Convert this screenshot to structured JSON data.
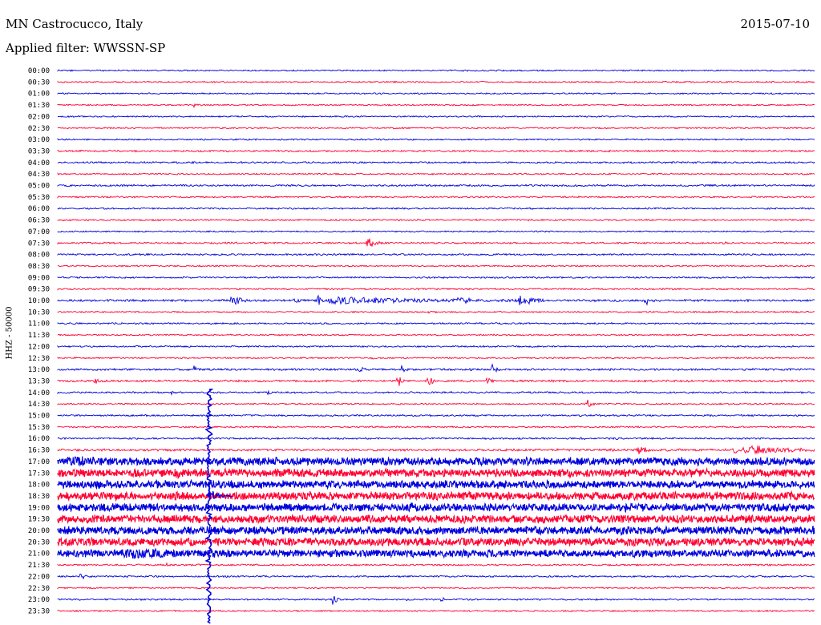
{
  "header": {
    "station": "MN Castrocucco, Italy",
    "date": "2015-07-10",
    "filter": "Applied filter: WWSSN-SP",
    "channel_label": "HHZ - 50000"
  },
  "chart_data": {
    "type": "line",
    "title": "MN Castrocucco, Italy",
    "x_unit": "minutes past row start",
    "xlim": [
      0,
      30
    ],
    "series_colors": [
      "#0000dd",
      "#ff0033"
    ],
    "rows": [
      {
        "label": "00:00",
        "amp": 1,
        "events": []
      },
      {
        "label": "00:30",
        "amp": 1,
        "events": []
      },
      {
        "label": "01:00",
        "amp": 1,
        "events": []
      },
      {
        "label": "01:30",
        "amp": 1,
        "events": [
          [
            5.4,
            2,
            0.3
          ]
        ]
      },
      {
        "label": "02:00",
        "amp": 1,
        "events": []
      },
      {
        "label": "02:30",
        "amp": 1,
        "events": []
      },
      {
        "label": "03:00",
        "amp": 1,
        "events": []
      },
      {
        "label": "03:30",
        "amp": 1.2,
        "events": []
      },
      {
        "label": "04:00",
        "amp": 1.2,
        "events": []
      },
      {
        "label": "04:30",
        "amp": 1,
        "events": []
      },
      {
        "label": "05:00",
        "amp": 1.3,
        "events": []
      },
      {
        "label": "05:30",
        "amp": 1.1,
        "events": []
      },
      {
        "label": "06:00",
        "amp": 1.1,
        "events": []
      },
      {
        "label": "06:30",
        "amp": 1.1,
        "events": []
      },
      {
        "label": "07:00",
        "amp": 1,
        "events": []
      },
      {
        "label": "07:30",
        "amp": 1.2,
        "events": [
          [
            12.2,
            10,
            0.7
          ],
          [
            26.4,
            2,
            0.2
          ]
        ]
      },
      {
        "label": "08:00",
        "amp": 1.2,
        "events": []
      },
      {
        "label": "08:30",
        "amp": 1,
        "events": []
      },
      {
        "label": "09:00",
        "amp": 1.1,
        "events": []
      },
      {
        "label": "09:30",
        "amp": 1.1,
        "events": []
      },
      {
        "label": "10:00",
        "amp": 1.5,
        "events": [
          [
            6.9,
            10,
            0.6
          ],
          [
            9.4,
            4,
            0.3
          ],
          [
            10.3,
            8,
            0.5
          ],
          [
            10.8,
            4,
            8.0
          ],
          [
            15.9,
            8,
            0.5
          ],
          [
            18.3,
            9,
            1.0
          ],
          [
            23.3,
            8,
            0.3
          ]
        ]
      },
      {
        "label": "10:30",
        "amp": 1,
        "events": [
          [
            14.7,
            2,
            0.3
          ]
        ]
      },
      {
        "label": "11:00",
        "amp": 1.1,
        "events": [
          [
            18.7,
            2,
            0.2
          ]
        ]
      },
      {
        "label": "11:30",
        "amp": 1,
        "events": []
      },
      {
        "label": "12:00",
        "amp": 1.1,
        "events": []
      },
      {
        "label": "12:30",
        "amp": 1,
        "events": [
          [
            12.4,
            2,
            0.3
          ]
        ]
      },
      {
        "label": "13:00",
        "amp": 1.4,
        "events": [
          [
            5.4,
            5,
            0.2
          ],
          [
            12.0,
            5,
            0.3
          ],
          [
            13.6,
            6,
            0.3
          ],
          [
            16.3,
            4,
            0.2
          ],
          [
            17.2,
            7,
            0.4
          ]
        ]
      },
      {
        "label": "13:30",
        "amp": 1.4,
        "events": [
          [
            1.5,
            4,
            0.4
          ],
          [
            13.5,
            7,
            0.4
          ],
          [
            14.7,
            7,
            0.4
          ],
          [
            17.0,
            5,
            0.3
          ]
        ]
      },
      {
        "label": "14:00",
        "amp": 1.2,
        "events": [
          [
            4.5,
            2,
            0.2
          ],
          [
            8.3,
            4,
            0.2
          ]
        ]
      },
      {
        "label": "14:30",
        "amp": 1,
        "events": [
          [
            21.0,
            5,
            0.4
          ]
        ]
      },
      {
        "label": "15:00",
        "amp": 1.2,
        "events": []
      },
      {
        "label": "15:30",
        "amp": 1.1,
        "events": []
      },
      {
        "label": "16:00",
        "amp": 1.2,
        "events": [
          [
            20.7,
            2,
            0.3
          ],
          [
            22.1,
            2,
            0.3
          ]
        ]
      },
      {
        "label": "16:30",
        "amp": 1.6,
        "events": [
          [
            23.0,
            7,
            0.6
          ],
          [
            26.8,
            6,
            0.3
          ],
          [
            27.2,
            8,
            3.0
          ]
        ]
      },
      {
        "label": "17:00",
        "amp": 5.5,
        "events": [
          [
            0.4,
            7,
            0.9
          ]
        ]
      },
      {
        "label": "17:30",
        "amp": 5.5,
        "events": [
          [
            4.7,
            4,
            0.5
          ]
        ]
      },
      {
        "label": "18:00",
        "amp": 5.5,
        "events": []
      },
      {
        "label": "18:30",
        "amp": 5.5,
        "events": []
      },
      {
        "label": "19:00",
        "amp": 5.5,
        "events": [
          [
            14.0,
            3,
            0.2
          ]
        ]
      },
      {
        "label": "19:30",
        "amp": 5.5,
        "events": []
      },
      {
        "label": "20:00",
        "amp": 5.5,
        "events": []
      },
      {
        "label": "20:30",
        "amp": 5.5,
        "events": []
      },
      {
        "label": "21:00",
        "amp": 5,
        "events": [
          [
            2.6,
            5,
            2.5
          ],
          [
            6.0,
            3,
            0.5
          ]
        ]
      },
      {
        "label": "21:30",
        "amp": 1.2,
        "events": [
          [
            4.3,
            2,
            0.2
          ]
        ]
      },
      {
        "label": "22:00",
        "amp": 1.2,
        "events": [
          [
            0.9,
            6,
            0.3
          ]
        ]
      },
      {
        "label": "22:30",
        "amp": 1,
        "events": []
      },
      {
        "label": "23:00",
        "amp": 1.1,
        "events": [
          [
            10.9,
            8,
            0.3
          ],
          [
            13.8,
            2,
            0.2
          ],
          [
            15.2,
            4,
            0.2
          ]
        ]
      },
      {
        "label": "23:30",
        "amp": 1,
        "events": []
      }
    ],
    "quake": {
      "x": 6.0,
      "rows": [
        "17:00",
        "17:30",
        "18:00",
        "18:30",
        "19:00",
        "19:30",
        "20:00",
        "20:30",
        "21:00",
        "21:30"
      ],
      "peak_row": "18:30"
    }
  }
}
